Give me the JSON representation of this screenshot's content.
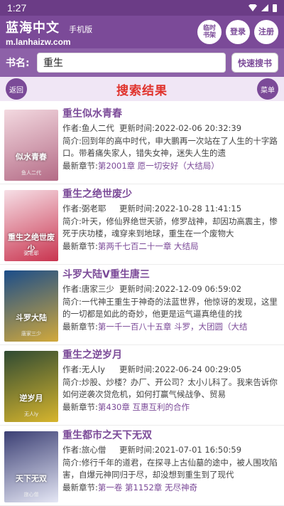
{
  "status_bar": {
    "time": "1:27"
  },
  "header": {
    "site_name": "蓝海中文",
    "site_tag": "手机版",
    "site_url": "m.lanhaizw.com",
    "btn_bookshelf": "临时\n书架",
    "btn_login": "登录",
    "btn_register": "注册"
  },
  "search": {
    "label": "书名:",
    "value": "重生",
    "button": "快速搜书"
  },
  "title_bar": {
    "back": "返回",
    "title": "搜索结果",
    "menu": "菜单"
  },
  "labels": {
    "author": "作者:",
    "update_time": "更新时间:",
    "intro": "简介:",
    "latest": "最新章节:"
  },
  "books": [
    {
      "title": "重生似水青春",
      "author": "鱼人二代",
      "updated": "2022-02-06 20:32:39",
      "intro": "回到年的高中时代，申大鹏再一次站在了人生的十字路口。带着痛失家人，错失女神，迷失人生的遗",
      "latest": "第2001章 愿一切安好（大结局）",
      "cover_text": "似水青春",
      "cover_colors": [
        "#f3d9e0",
        "#b46b86"
      ]
    },
    {
      "title": "重生之绝世废少",
      "author": "弼老耶",
      "updated": "2022-10-28 11:41:15",
      "intro": "叶天，修仙界绝世天骄，修罗战神，却因功高震主，惨死于庆功楼，魂穿来到地球，重生在一个废物大",
      "latest": "第两千七百二十一章 大结局",
      "cover_text": "重生之绝世废少",
      "cover_colors": [
        "#f6dfe6",
        "#c9344f"
      ]
    },
    {
      "title": "斗罗大陆V重生唐三",
      "author": "唐家三少",
      "updated": "2022-12-09 06:59:02",
      "intro": "一代神王重生于神奇的法蓝世界，他惊讶的发现，这里的一切都是如此的奇妙，他更是运气逼真绝佳的找",
      "latest": "第一千一百八十五章 斗罗，大团圆（大结",
      "cover_text": "斗罗大陆",
      "cover_colors": [
        "#1b4d8a",
        "#d2a93b"
      ]
    },
    {
      "title": "重生之逆岁月",
      "author": "无人ly",
      "updated": "2022-06-24 00:29:05",
      "intro": "炒股、炒楼？办厂、开公司？太小儿科了。我来告诉你如何逆袭次贷危机，如何打赢气候战争、贸易",
      "latest": "第430章 互惠互利的合作",
      "cover_text": "逆岁月",
      "cover_colors": [
        "#2f4a33",
        "#d7b52d"
      ]
    },
    {
      "title": "重生都市之天下无双",
      "author": "旅心僧",
      "updated": "2021-07-01 16:50:59",
      "intro": "修行千年的道君，在探寻上古仙墓的途中，被人围攻陷害，自爆元神同归于尽，却没想到重生到了现代",
      "latest": "第一卷 第1152章 无尽神奇",
      "cover_text": "天下无双",
      "cover_colors": [
        "#3b3f74",
        "#e5e7f5"
      ]
    }
  ]
}
